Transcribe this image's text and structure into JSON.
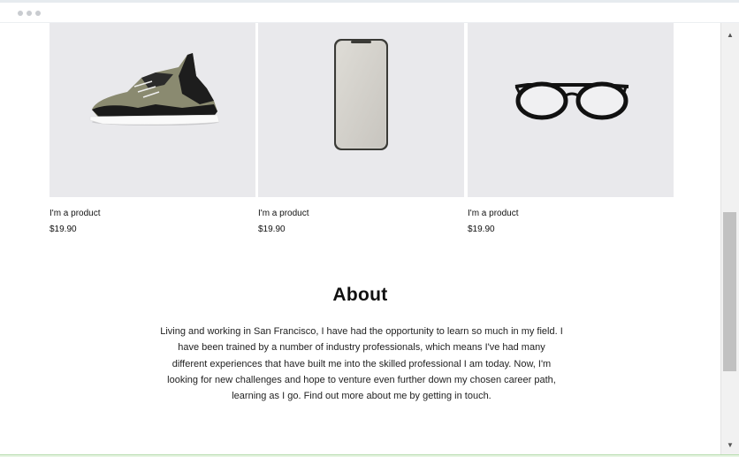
{
  "window": {
    "controls": [
      "dot",
      "dot",
      "dot"
    ]
  },
  "products": [
    {
      "name": "I'm a product",
      "price": "$19.90",
      "image": "sneaker"
    },
    {
      "name": "I'm a product",
      "price": "$19.90",
      "image": "smartphone"
    },
    {
      "name": "I'm a product",
      "price": "$19.90",
      "image": "eyeglasses"
    }
  ],
  "about": {
    "title": "About",
    "text": "Living and working in San Francisco, I have had the opportunity to learn so much in my field. I have been trained by a number of industry professionals, which means I've had many different experiences that have built me into the skilled professional I am today. Now, I'm looking for new challenges and hope to venture even further down my chosen career path, learning as I go. Find out more about me by getting in touch."
  },
  "scrollbar": {
    "up_icon": "▲",
    "down_icon": "▼"
  }
}
